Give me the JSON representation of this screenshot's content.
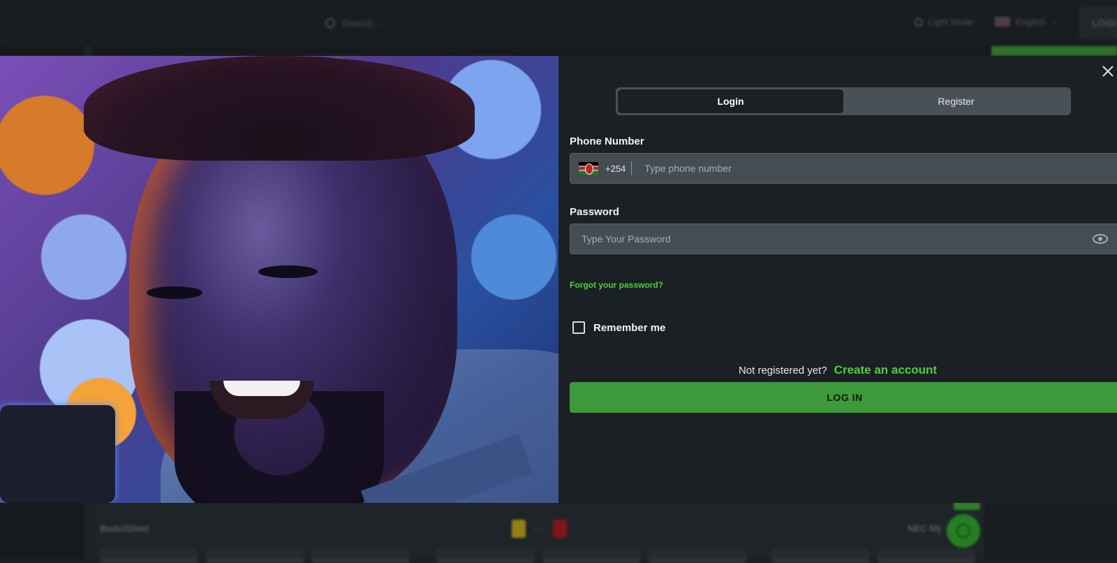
{
  "background": {
    "search_placeholder": "Search...",
    "light_mode_label": "Light Mode",
    "language": "English",
    "login_button": "LOGI",
    "match_home": "Bodo/Glimt",
    "league": "NEC Nij"
  },
  "modal": {
    "tabs": [
      {
        "label": "Login",
        "active": true
      },
      {
        "label": "Register",
        "active": false
      }
    ],
    "phone": {
      "label": "Phone Number",
      "country_code": "+254",
      "placeholder": "Type phone number",
      "flag_icon": "kenya-flag-icon"
    },
    "password": {
      "label": "Password",
      "placeholder": "Type Your Password",
      "toggle_icon": "eye-icon"
    },
    "forgot_password": "Forgot your password?",
    "remember_me": "Remember me",
    "not_registered": "Not registered yet?",
    "create_account": "Create an account",
    "login_button": "LOG IN"
  },
  "colors": {
    "accent_green": "#4cd13b",
    "button_green": "#3c9a3a",
    "panel_bg": "#1b2024",
    "input_bg": "#454c52"
  }
}
